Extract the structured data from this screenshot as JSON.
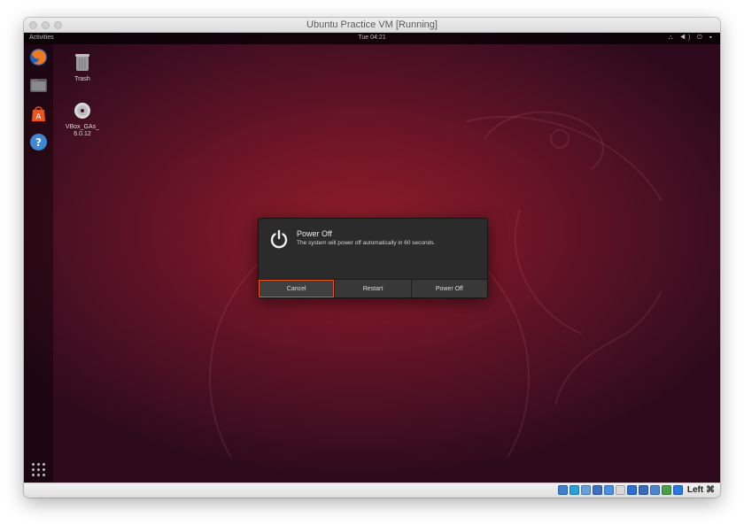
{
  "window": {
    "title": "Ubuntu Practice VM [Running]"
  },
  "topbar": {
    "activities": "Activities",
    "clock": "Tue 04:21",
    "tray": "⛬ ◀) ⏻ ▾"
  },
  "dock": {
    "items": [
      {
        "name": "firefox-icon",
        "color": "#e66000"
      },
      {
        "name": "files-icon",
        "color": "#6e6e6e"
      },
      {
        "name": "software-center-icon",
        "color": "#e95420"
      },
      {
        "name": "help-icon",
        "color": "#3d88d6"
      }
    ]
  },
  "desktop": {
    "icons": [
      {
        "label": "Trash",
        "icon": "trash-icon"
      },
      {
        "label": "VBox_GAs_\n6.0.12",
        "icon": "disc-icon"
      }
    ]
  },
  "dialog": {
    "title": "Power Off",
    "message": "The system will power off automatically in 60 seconds.",
    "buttons": {
      "cancel": "Cancel",
      "restart": "Restart",
      "power_off": "Power Off"
    },
    "focus_color": "#e95420"
  },
  "statusbar": {
    "icons": [
      {
        "name": "disk-icon",
        "color": "#3f7fcf"
      },
      {
        "name": "optical-drive-icon",
        "color": "#2a9fd8"
      },
      {
        "name": "audio-icon",
        "color": "#6aa0d8"
      },
      {
        "name": "network-icon",
        "color": "#3b6fc0"
      },
      {
        "name": "usb-icon",
        "color": "#4b8fe0"
      },
      {
        "name": "shared-folder-icon",
        "color": "#d9d9d9"
      },
      {
        "name": "display-icon",
        "color": "#2d6ed0"
      },
      {
        "name": "recording-icon",
        "color": "#3a6ab8"
      },
      {
        "name": "cpu-icon",
        "color": "#4d84d0"
      },
      {
        "name": "mouse-integration-icon",
        "color": "#49a049"
      },
      {
        "name": "keyboard-capture-icon",
        "color": "#2b78e0"
      }
    ],
    "host_key": "Left ⌘"
  }
}
